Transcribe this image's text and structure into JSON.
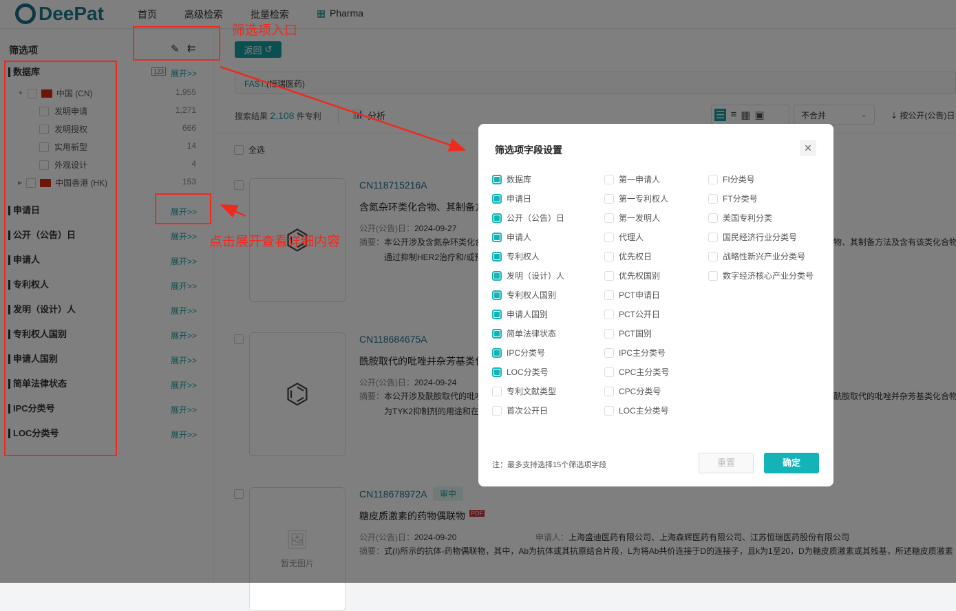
{
  "header": {
    "logo": "DeePat",
    "nav": [
      "首页",
      "高级检索",
      "批量检索",
      "Pharma"
    ]
  },
  "sidebar": {
    "title": "筛选项",
    "expand_label": "展开>>",
    "database": {
      "label": "数据库",
      "tree": [
        {
          "label": "中国 (CN)",
          "count": "1,955"
        },
        {
          "label": "发明申请",
          "count": "1,271"
        },
        {
          "label": "发明授权",
          "count": "666"
        },
        {
          "label": "实用新型",
          "count": "14"
        },
        {
          "label": "外观设计",
          "count": "4"
        },
        {
          "label": "中国香港 (HK)",
          "count": "153"
        }
      ]
    },
    "sections": [
      "申请日",
      "公开（公告）日",
      "申请人",
      "专利权人",
      "发明（设计）人",
      "专利权人国别",
      "申请人国别",
      "简单法律状态",
      "IPC分类号",
      "LOC分类号"
    ]
  },
  "main": {
    "back_label": "返回",
    "query_prefix": "FAST:",
    "query": "(恒瑞医药)",
    "results_prefix": "搜索结果",
    "results_count": "2,108",
    "results_suffix": "件专利",
    "analyze_label": "分析",
    "merge_select": "不合并",
    "sort_label": "按公开(公告)日",
    "select_all": "全选",
    "date_label": "公开(公告)日：",
    "abstract_label": "摘要：",
    "applicant_label": "申请人：",
    "no_image": "暂无图片",
    "results": [
      {
        "pn": "CN118715216A",
        "title": "含氮杂环类化合物、其制备方",
        "date": "2024-09-27",
        "abstract1": "本公开涉及含氮杂环类化合",
        "abstract_right": "物、其制备方法及含有该类化合物的",
        "abstract2": "通过抑制HER2治疗和/或预"
      },
      {
        "pn": "CN118684675A",
        "title": "酰胺取代的吡唑并杂芳基类化",
        "date": "2024-09-24",
        "abstract1": "本公开涉及酰胺取代的吡唑",
        "abstract_right": "酰胺取代的吡唑并杂芳基类化合物、",
        "abstract2": "为TYK2抑制剂的用途和在"
      },
      {
        "pn": "CN118678972A",
        "badge": "审中",
        "title": "糖皮质激素的药物偶联物",
        "date": "2024-09-20",
        "applicants": "上海盛迪医药有限公司、上海森辉医药有限公司、江苏恒瑞医药股份有限公司",
        "abstract1": "式(I)所示的抗体-药物偶联物，其中，Ab为抗体或其抗原结合片段，L为将Ab共价连接于D的连接子，且k为1至20，D为糖皮质激素或其残基，所述糖皮质激素"
      }
    ]
  },
  "annotations": {
    "entry": "筛选项入口",
    "expand_hint": "点击展开查看详细内容"
  },
  "dialog": {
    "title": "筛选项字段设置",
    "columns": [
      [
        {
          "l": "数据库",
          "on": true
        },
        {
          "l": "申请日",
          "on": true
        },
        {
          "l": "公开（公告）日",
          "on": true
        },
        {
          "l": "申请人",
          "on": true
        },
        {
          "l": "专利权人",
          "on": true
        },
        {
          "l": "发明（设计）人",
          "on": true
        },
        {
          "l": "专利权人国别",
          "on": true
        },
        {
          "l": "申请人国别",
          "on": true
        },
        {
          "l": "简单法律状态",
          "on": true
        },
        {
          "l": "IPC分类号",
          "on": true
        },
        {
          "l": "LOC分类号",
          "on": true
        },
        {
          "l": "专利文献类型",
          "on": false
        },
        {
          "l": "首次公开日",
          "on": false
        }
      ],
      [
        {
          "l": "第一申请人",
          "on": false
        },
        {
          "l": "第一专利权人",
          "on": false
        },
        {
          "l": "第一发明人",
          "on": false
        },
        {
          "l": "代理人",
          "on": false
        },
        {
          "l": "优先权日",
          "on": false
        },
        {
          "l": "优先权国别",
          "on": false
        },
        {
          "l": "PCT申请日",
          "on": false
        },
        {
          "l": "PCT公开日",
          "on": false
        },
        {
          "l": "PCT国别",
          "on": false
        },
        {
          "l": "IPC主分类号",
          "on": false
        },
        {
          "l": "CPC主分类号",
          "on": false
        },
        {
          "l": "CPC分类号",
          "on": false
        },
        {
          "l": "LOC主分类号",
          "on": false
        }
      ],
      [
        {
          "l": "FI分类号",
          "on": false
        },
        {
          "l": "FT分类号",
          "on": false
        },
        {
          "l": "美国专利分类",
          "on": false
        },
        {
          "l": "国民经济行业分类号",
          "on": false
        },
        {
          "l": "战略性新兴产业分类号",
          "on": false
        },
        {
          "l": "数字经济核心产业分类号",
          "on": false
        }
      ]
    ],
    "note": "注：最多支持选择15个筛选项字段",
    "reset_label": "重置",
    "confirm_label": "确定"
  },
  "colors": {
    "accent": "#14b3b8",
    "annotation": "#f0291d"
  }
}
